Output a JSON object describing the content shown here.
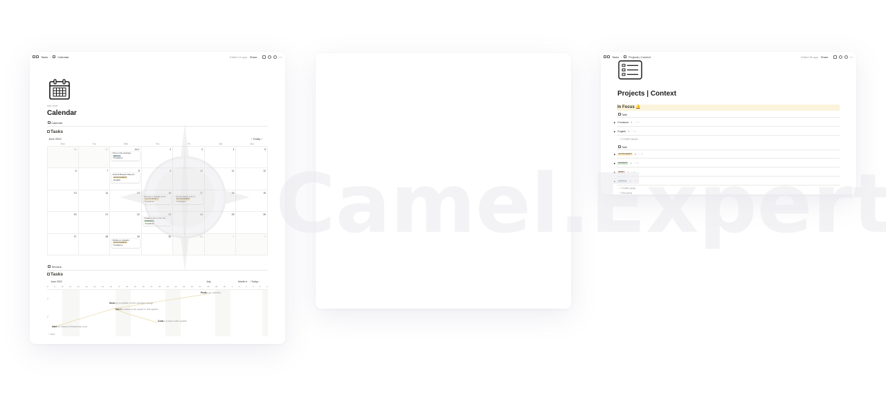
{
  "calendar_page": {
    "breadcrumb": [
      "Tasks",
      "Calendar"
    ],
    "edited": "Edited 1h ago",
    "share": "Share",
    "icon": "calendar-icon",
    "meta": "Add cover",
    "title": "Calendar",
    "view_tab": "Calendar",
    "db_title": "Tasks",
    "month": "June 2022",
    "today": "Today",
    "days_of_week": [
      "Mon",
      "Tue",
      "Wed",
      "Thu",
      "Fri",
      "Sat",
      "Sun"
    ],
    "weeks": [
      {
        "days": [
          {
            "n": "30",
            "muted": true,
            "events": []
          },
          {
            "n": "31",
            "muted": true,
            "events": []
          },
          {
            "n": "Jul 1",
            "events": [
              {
                "title": "Post on the stockpot...",
                "tag": "HEALTH",
                "tag_color": "#d3e5ef",
                "project": "Freelance"
              }
            ]
          },
          {
            "n": "2",
            "events": []
          },
          {
            "n": "3",
            "events": []
          },
          {
            "n": "4",
            "events": []
          },
          {
            "n": "5",
            "events": []
          }
        ]
      },
      {
        "days": [
          {
            "n": "6",
            "events": []
          },
          {
            "n": "7",
            "events": []
          },
          {
            "n": "8",
            "events": [
              {
                "title": "Internal Repeat Video (fr...",
                "tag": "ADVANCEMENT",
                "tag_color": "#fdecc8",
                "project": "English"
              }
            ]
          },
          {
            "n": "9",
            "events": []
          },
          {
            "n": "10",
            "events": []
          },
          {
            "n": "11",
            "events": []
          },
          {
            "n": "12",
            "events": []
          }
        ]
      },
      {
        "days": [
          {
            "n": "13",
            "events": []
          },
          {
            "n": "14",
            "events": []
          },
          {
            "n": "15",
            "events": []
          },
          {
            "n": "16",
            "events": [
              {
                "title": "Develop a website on th...",
                "tag": "ADVANCEMENT",
                "tag_color": "#fdecc8",
                "project": "Freelance"
              }
            ]
          },
          {
            "n": "17",
            "events": [
              {
                "title": "Get the status of an a...",
                "tag": "ADVANCEMENT",
                "tag_color": "#fdecc8",
                "project": "Freelance"
              }
            ]
          },
          {
            "n": "18",
            "events": []
          },
          {
            "n": "19",
            "events": []
          }
        ]
      },
      {
        "days": [
          {
            "n": "20",
            "events": []
          },
          {
            "n": "21",
            "events": []
          },
          {
            "n": "22",
            "events": []
          },
          {
            "n": "23",
            "events": [
              {
                "title": "Create a team order pro...",
                "tag": "BUSINESS",
                "tag_color": "#dbeddb",
                "project": "Freelance"
              }
            ]
          },
          {
            "n": "24",
            "events": []
          },
          {
            "n": "25",
            "events": []
          },
          {
            "n": "26",
            "events": []
          }
        ]
      },
      {
        "days": [
          {
            "n": "27",
            "events": []
          },
          {
            "n": "28",
            "events": []
          },
          {
            "n": "29",
            "events": [
              {
                "title": "Profile on LinkedIn",
                "tag": "ADVANCEMENT",
                "tag_color": "#fdecc8",
                "project": "Freelance"
              }
            ]
          },
          {
            "n": "30",
            "events": []
          },
          {
            "n": "Jul",
            "muted": true,
            "events": []
          },
          {
            "n": "1",
            "muted": true,
            "events": []
          },
          {
            "n": "2",
            "muted": true,
            "events": []
          }
        ]
      }
    ],
    "timeline_tab": "Timeline",
    "timeline_db_title": "Tasks",
    "timeline_month": "June 2022",
    "timeline_month2": "July",
    "timeline_ctl": "Month",
    "timeline_today": "Today",
    "timeline_days": [
      "8",
      "9",
      "10",
      "11",
      "12",
      "13",
      "14",
      "15",
      "16",
      "17",
      "18",
      "19",
      "20",
      "21",
      "22",
      "23",
      "24",
      "25",
      "26",
      "27",
      "28",
      "29",
      "30",
      "1",
      "2",
      "3",
      "4",
      "5",
      "6"
    ],
    "timeline_items": [
      {
        "bold": "Profi",
        "rest": "le on LinkedIn"
      },
      {
        "bold": "Deve",
        "rest": "lop a website on the standard design"
      },
      {
        "bold": "Get t",
        "rest": "he status of an expert in this sphere"
      },
      {
        "bold": "Crea",
        "rest": "te a team order system"
      },
      {
        "bold": "Inter",
        "rest": "nal Repeat (fr/business.com)"
      }
    ],
    "new_label": "+ New"
  },
  "projects_page": {
    "breadcrumb": [
      "Tasks",
      "Projects | Context"
    ],
    "edited": "Edited 5h ago",
    "share": "Share",
    "icon": "list-icon",
    "title": "Projects | Context",
    "in_focus": "In Focus 🔔",
    "view1": "Table",
    "group1": [
      {
        "name": "Freelance",
        "count": "4"
      },
      {
        "name": "English",
        "count": "3"
      }
    ],
    "hidden1": "12 hidden groups",
    "view2": "Table",
    "group2": [
      {
        "name": "ADVANCEMENT",
        "count": "6",
        "color": "#fdecc8"
      },
      {
        "name": "BUSINESS",
        "count": "4",
        "color": "#dbeddb"
      },
      {
        "name": "FAMILY",
        "count": "2",
        "color": "#ffe2dd"
      },
      {
        "name": "FINANCE",
        "count": "11",
        "color": "#d3e5ef"
      }
    ],
    "hidden2": "1 hidden group",
    "new_group": "New group"
  },
  "watermark": "Camel.Expert"
}
